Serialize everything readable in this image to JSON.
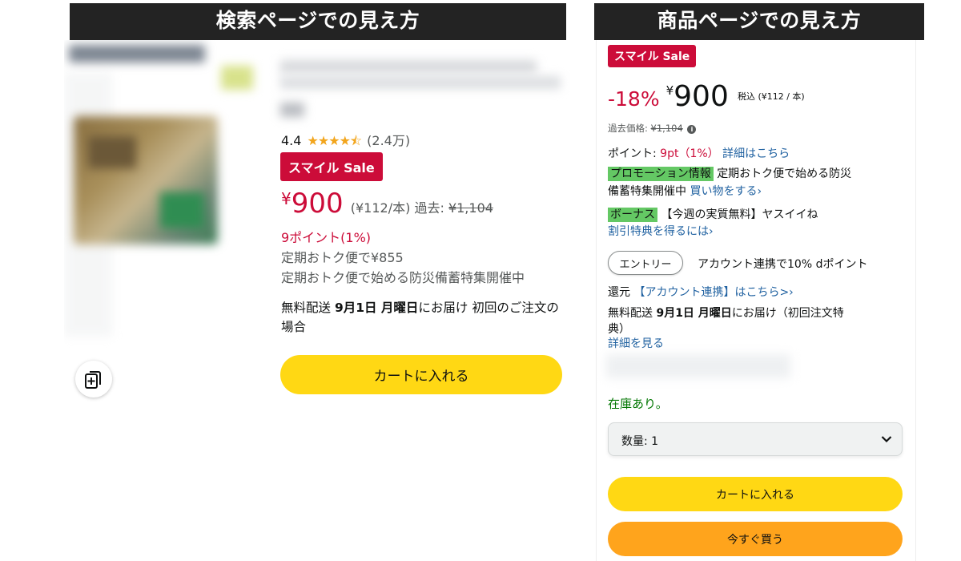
{
  "headers": {
    "left": "検索ページでの見え方",
    "right": "商品ページでの見え方"
  },
  "search_result": {
    "rating": "4.4",
    "rating_stars": 4.4,
    "review_count": "(2.4万)",
    "sale_badge": "スマイル Sale",
    "price_yen": "¥",
    "price_amount": "900",
    "unit_price": "(¥112/本)",
    "past_label": "過去:",
    "past_price": "¥1,104",
    "points": "9ポイント(1%)",
    "subscription_price": "定期おトク便で¥855",
    "subscription_campaign": "定期おトク便で始める防災備蓄特集開催中",
    "delivery_prefix": "無料配送 ",
    "delivery_date": "9月1日 月曜日",
    "delivery_suffix": "にお届け 初回のご注文の場合",
    "cart_button": "カートに入れる"
  },
  "product_page": {
    "sale_badge": "スマイル Sale",
    "discount": "-18%",
    "price_yen": "¥",
    "price_amount": "900",
    "tax_unit": "税込 (¥112 / 本)",
    "past_label": "過去価格: ",
    "past_price": "¥1,104",
    "points_label": "ポイント: ",
    "points_value": "9pt（1%）",
    "points_link": "詳細はこちら",
    "promo_tag": "プロモーション情報",
    "promo_text_1": "定期おトク便で始める防災",
    "promo_text_2": "備蓄特集開催中",
    "promo_link": "買い物をする›",
    "bonus_tag": "ボーナス",
    "bonus_text": "【今週の実質無料】ヤスイイね",
    "bonus_link": "割引特典を得るには›",
    "entry_button": "エントリー",
    "entry_text": "アカウント連携で10% dポイント",
    "shougen_label": "還元",
    "shougen_link": "【アカウント連携】はこちら>›",
    "delivery_prefix": "無料配送 ",
    "delivery_date": "9月1日 月曜日",
    "delivery_suffix": "にお届け（初回注文特",
    "delivery_suffix_2": "典）",
    "detail_link": "詳細を見る",
    "stock": "在庫あり。",
    "quantity": "数量: 1",
    "cart_button": "カートに入れる",
    "buy_now_button": "今すぐ買う"
  },
  "colors": {
    "sale_red": "#cc0c39",
    "cart_yellow": "#ffd814",
    "buy_orange": "#ffa41c",
    "link_blue": "#2162a1",
    "stock_green": "#007600",
    "tag_green": "#64c864"
  },
  "icons": {
    "compare": "compare-icon",
    "star": "star-icon",
    "chevron": "chevron-down-icon",
    "info": "info-icon"
  }
}
